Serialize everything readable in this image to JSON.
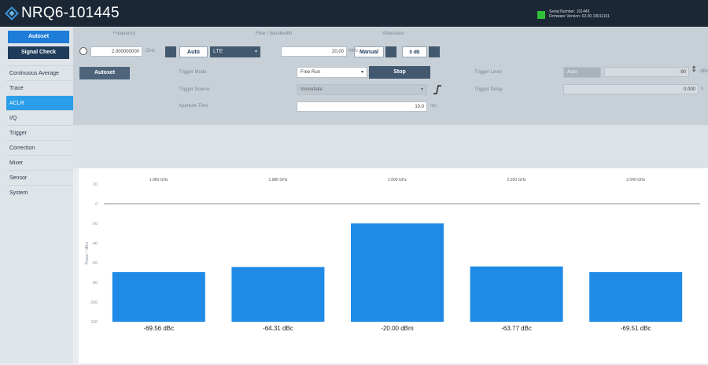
{
  "app": {
    "title": "NRQ6-101445",
    "serial_line": "Serial Number: 101445",
    "firmware_line": "Firmware Version: 02.00.19011101"
  },
  "sidebar": {
    "autoset_label": "Autoset",
    "signal_check_label": "Signal Check",
    "items": [
      {
        "label": "Continuous Average",
        "active": false
      },
      {
        "label": "Trace",
        "active": false
      },
      {
        "label": "ACLR",
        "active": true
      },
      {
        "label": "I/Q",
        "active": false
      },
      {
        "label": "Trigger",
        "active": false
      },
      {
        "label": "Correction",
        "active": false
      },
      {
        "label": "Mixer",
        "active": false
      },
      {
        "label": "Sensor",
        "active": false
      },
      {
        "label": "System",
        "active": false
      }
    ]
  },
  "config": {
    "frequency_header": "Frequency",
    "frequency_value": "2.000000000",
    "frequency_unit": "GHz",
    "filter_header": "Filter / Bandwidth",
    "auto_label": "Auto",
    "standard_value": "LTE",
    "bandwidth_value": "20.00",
    "bandwidth_unit": "MHz",
    "attenuator_header": "Attenuator",
    "manual_label": "Manual",
    "attenuation_value": "0 dB"
  },
  "trigger": {
    "autoset_label": "Autoset",
    "mode_label": "Trigger Mode",
    "mode_value": "Free Run",
    "stop_label": "Stop",
    "source_label": "Trigger Source",
    "source_value": "Immediate",
    "aperture_label": "Aperture Time",
    "aperture_value": "10.0",
    "aperture_unit": "ms",
    "level_label": "Trigger Level",
    "level_mode": "Auto",
    "level_value": "-90",
    "level_unit": "dBm",
    "delay_label": "Trigger Delay",
    "delay_value": "0.000",
    "delay_unit": "s"
  },
  "chart_data": {
    "type": "bar",
    "categories": [
      "1.960 GHz",
      "1.980 GHz",
      "2.000 GHz",
      "2.020 GHz",
      "2.040 GHz"
    ],
    "values": [
      -69.56,
      -64.31,
      -20.0,
      -63.77,
      -69.51
    ],
    "data_labels": [
      "-69.56 dBc",
      "-64.31 dBc",
      "-20.00 dBm",
      "-63.77 dBc",
      "-69.51 dBc"
    ],
    "ylabel": "Power / dBm",
    "ylim": [
      -120,
      20
    ],
    "yticks": [
      "20",
      "0",
      "-20",
      "-40",
      "-60",
      "-80",
      "-100",
      "-120"
    ],
    "bar_color": "#1f8be6"
  },
  "colors": {
    "title_bar": "#1b2735",
    "accent": "#2a9ee9",
    "status_led": "#2fbf3a"
  }
}
